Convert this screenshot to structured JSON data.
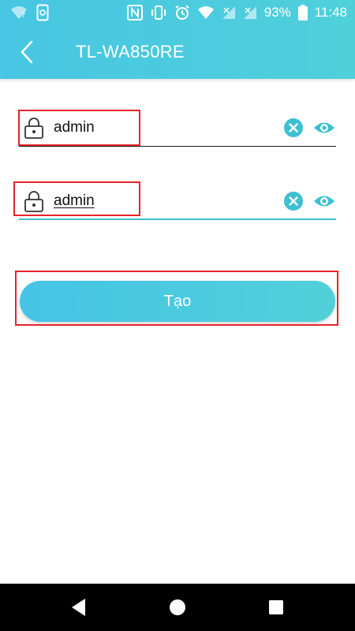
{
  "status_bar": {
    "battery_percent": "93%",
    "time": "11:48",
    "icons": [
      "wifi-question-icon",
      "sim-card-icon",
      "nfc-icon",
      "vibrate-icon",
      "alarm-icon",
      "wifi-icon",
      "signal-icon",
      "signal-icon",
      "battery-icon"
    ]
  },
  "header": {
    "title": "TL-WA850RE",
    "back_icon": "chevron-left-icon",
    "color": "#4ac9e0"
  },
  "form": {
    "password_value": "admin",
    "confirm_value": "admin",
    "lock_icon": "lock-icon",
    "clear_icon": "clear-x-icon",
    "visibility_icon": "eye-icon",
    "accent": "#3dbfd4",
    "highlight": "#e5242b"
  },
  "actions": {
    "create_label": "Tạo"
  },
  "nav_bar": {
    "buttons": [
      "back-triangle-icon",
      "home-circle-icon",
      "recents-square-icon"
    ]
  }
}
